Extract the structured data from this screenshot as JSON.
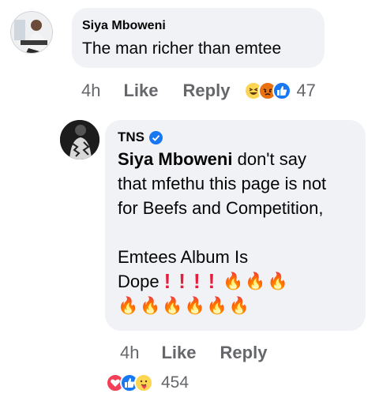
{
  "comment1": {
    "author": "Siya Mboweni",
    "text": "The man richer than emtee",
    "time": "4h",
    "like_label": "Like",
    "reply_label": "Reply",
    "reaction_count": "47",
    "reactions": [
      "haha-icon",
      "angry-icon",
      "like-icon"
    ]
  },
  "reply1": {
    "author": "TNS",
    "verified": true,
    "mention": "Siya Mboweni",
    "line1_rest": " don't say",
    "line2": "that mfethu this page is not",
    "line3": "for Beefs and Competition,",
    "line4": "Emtees Album Is",
    "line5_word": "Dope",
    "time": "4h",
    "like_label": "Like",
    "reply_label": "Reply",
    "reaction_count": "454",
    "reactions": [
      "love-icon",
      "like-icon",
      "care-icon"
    ]
  },
  "colors": {
    "bubble": "#f0f2f5",
    "meta_text": "#65676b",
    "like_blue": "#1877f2",
    "love_red": "#f33e58",
    "haha_yellow": "#fcd553",
    "angry_orange": "#e9710f",
    "verified_blue": "#1877f2"
  }
}
